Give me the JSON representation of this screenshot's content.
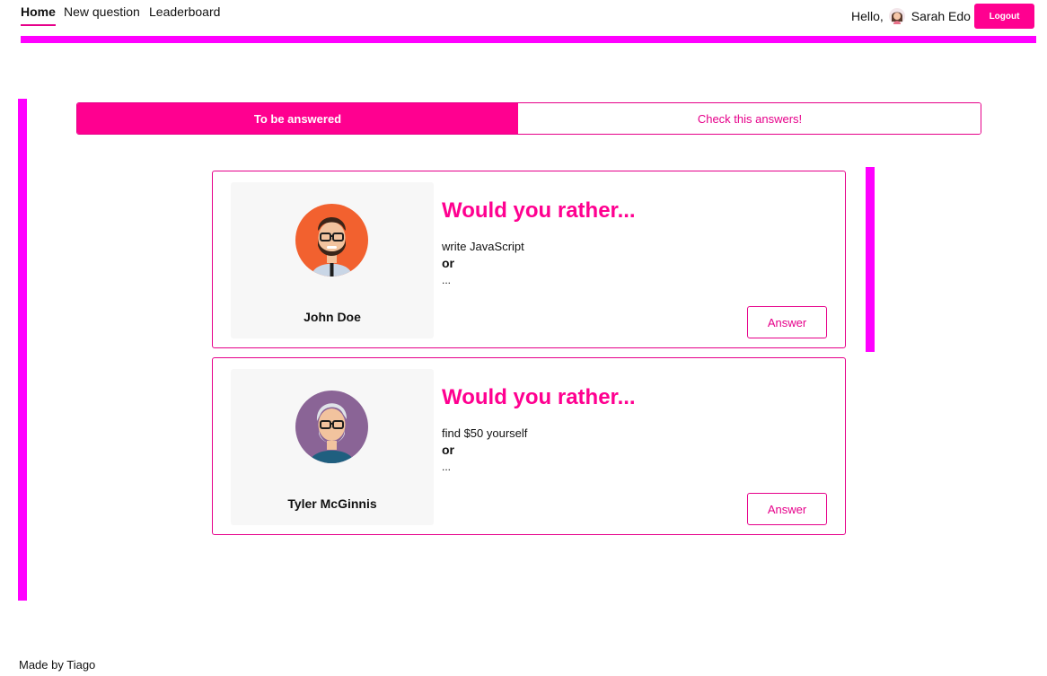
{
  "nav": {
    "links": [
      "Home",
      "New question",
      "Leaderboard"
    ],
    "active": "Home",
    "greeting": "Hello,",
    "user_name": "Sarah Edo",
    "logout_label": "Logout"
  },
  "tabs": {
    "items": [
      "To be answered",
      "Check this answers!"
    ],
    "active": "To be answered"
  },
  "questions": [
    {
      "author": "John Doe",
      "avatar": "bearded-man-avatar-icon",
      "title": "Would you rather...",
      "option_preview": "write JavaScript",
      "or_label": "or",
      "ellipsis": "...",
      "button_label": "Answer"
    },
    {
      "author": "Tyler McGinnis",
      "avatar": "gray-haired-man-avatar-icon",
      "title": "Would you rather...",
      "option_preview": "find $50 yourself",
      "or_label": "or",
      "ellipsis": "...",
      "button_label": "Answer"
    }
  ],
  "footer": {
    "text": "Made by Tiago"
  },
  "colors": {
    "accent": "#ff0090",
    "debug_bar": "#ff00ff",
    "panel_bg": "#f7f7f7"
  }
}
